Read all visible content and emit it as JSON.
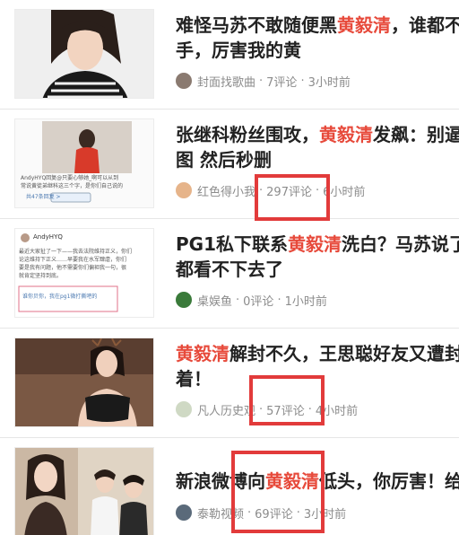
{
  "feed": {
    "items": [
      {
        "title_pre": "难怪马苏不敢随便黑",
        "title_hl": "黄毅清",
        "title_post": "，谁都不",
        "title_line2": "手，厉害我的黄",
        "source": "封面找歌曲",
        "comments": "7评论",
        "time": "3小时前",
        "avatar_color": "#8a7a70"
      },
      {
        "title_pre": "张继科粉丝围攻，",
        "title_hl": "黄毅清",
        "title_post": "发飙：别逼",
        "title_line2": "图 然后秒删",
        "source": "红色得小我",
        "comments": "297评论",
        "time": "6小时前",
        "avatar_color": "#e6b48a",
        "thumb_text": {
          "line1": "AndyHYQ回复@只要心够她_啊可以从到",
          "line2": "常说黄徒弟继科这三个字，是你们自己说的",
          "line3": "共47条回复 >"
        }
      },
      {
        "title_pre": "PG1私下联系",
        "title_hl": "黄毅清",
        "title_post": "洗白？马苏说了",
        "title_line2": "都看不下去了",
        "source": "桌娱鱼",
        "comments": "0评论",
        "time": "1小时前",
        "avatar_color": "#3a7a3a",
        "thumb_text": {
          "name": "AndyHYQ",
          "line1": "最近大家扯了一下——我去法院维持正义，你们",
          "line2": "论这维持下正义……早要我在水军肆虐，你们",
          "line3": "要是我有问题，他不需要你们偏袒我一句，很",
          "line4": "就肯定坚持到底。",
          "box": "谁你贝你，我在pg1微打撕吧的"
        }
      },
      {
        "title_pre": "",
        "title_hl": "黄毅清",
        "title_post": "解封不久，王思聪好友又遭封",
        "title_line2": "着！",
        "source": "凡人历史观",
        "comments": "57评论",
        "time": "4小时前",
        "avatar_color": "#cfd9c4"
      },
      {
        "title_pre": "新浪微博向",
        "title_hl": "黄毅清",
        "title_post": "低头，你厉害！给",
        "title_line2": "",
        "source": "泰勒视频",
        "comments": "69评论",
        "time": "3小时前",
        "avatar_color": "#5a6a7a"
      }
    ],
    "separator": "·"
  }
}
